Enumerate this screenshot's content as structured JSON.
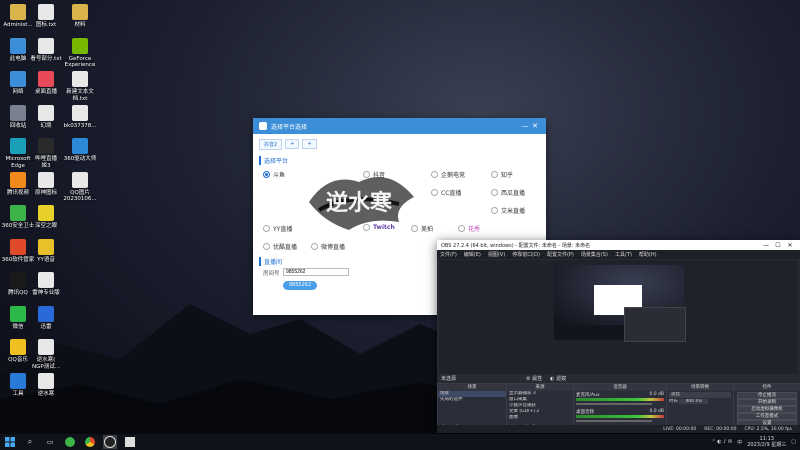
{
  "desktop": {
    "col1": [
      {
        "label": "Administ...",
        "icon": "folder-user-icon",
        "color": "#d9b44a"
      },
      {
        "label": "此电脑",
        "icon": "computer-icon",
        "color": "#3d8ed8"
      },
      {
        "label": "网络",
        "icon": "network-icon",
        "color": "#3d8ed8"
      },
      {
        "label": "回收站",
        "icon": "recycle-bin-icon",
        "color": "#7a8090"
      },
      {
        "label": "Microsoft\nEdge",
        "icon": "edge-icon",
        "color": "#1aa0b8"
      },
      {
        "label": "腾讯视频",
        "icon": "tencent-video-icon",
        "color": "#f08a1c"
      },
      {
        "label": "360安全卫士",
        "icon": "360-safe-icon",
        "color": "#3cb44a"
      },
      {
        "label": "360软件管家",
        "icon": "360-software-icon",
        "color": "#e04a2a"
      },
      {
        "label": "腾讯QQ",
        "icon": "qq-icon",
        "color": "#1a1a1a"
      },
      {
        "label": "微信",
        "icon": "wechat-icon",
        "color": "#2db84a"
      },
      {
        "label": "QQ音乐",
        "icon": "qq-music-icon",
        "color": "#f0c020"
      },
      {
        "label": "工具",
        "icon": "tools-icon",
        "color": "#2a7ad8"
      }
    ],
    "col2": [
      {
        "label": "图标.txt",
        "icon": "text-file-icon",
        "color": "#e8e8e8"
      },
      {
        "label": "看号部分.txt",
        "icon": "text-file-icon",
        "color": "#e8e8e8"
      },
      {
        "label": "桌面直播",
        "icon": "live-desktop-icon",
        "color": "#e84a5a"
      },
      {
        "label": "幻境",
        "icon": "illusion-icon",
        "color": "#e8e8e8"
      },
      {
        "label": "哔哩直播\n姬3",
        "icon": "bilibili-live-icon",
        "color": "#2a2a2a"
      },
      {
        "label": "原神图标",
        "icon": "genshin-icon",
        "color": "#e8e8e8"
      },
      {
        "label": "深空之眼",
        "icon": "deep-eye-icon",
        "color": "#e8d02a"
      },
      {
        "label": "YY语音",
        "icon": "yy-icon",
        "color": "#e8c02a"
      },
      {
        "label": "雷神专业版",
        "icon": "leishen-icon",
        "color": "#e8e8e8"
      },
      {
        "label": "迅雷",
        "icon": "xunlei-icon",
        "color": "#2a6ad8"
      },
      {
        "label": "逆水寒(\nNGP测试...",
        "icon": "nishuihan-icon",
        "color": "#e8e8e8"
      },
      {
        "label": "逆水寒",
        "icon": "nishuihan-icon",
        "color": "#e8e8e8"
      }
    ],
    "col3": [
      {
        "label": "材料",
        "icon": "folder-icon",
        "color": "#d9b44a"
      },
      {
        "label": "GeForce\nExperience",
        "icon": "geforce-icon",
        "color": "#76b900"
      },
      {
        "label": "新建文本文\n档.txt",
        "icon": "text-file-icon",
        "color": "#e8e8e8"
      },
      {
        "label": "bk037378...",
        "icon": "text-file-icon",
        "color": "#e8e8e8"
      },
      {
        "label": "360驱动大师",
        "icon": "360-driver-icon",
        "color": "#2a8ad8"
      },
      {
        "label": "QQ图片\n20230106...",
        "icon": "image-file-icon",
        "color": "#e8e8e8"
      }
    ]
  },
  "platform_window": {
    "title": "选择平台选择",
    "win_buttons": [
      "—",
      "✕"
    ],
    "tabs": [
      "抖音2",
      "+",
      "+"
    ],
    "section1": "选择平台",
    "section2": "直播间",
    "platforms": [
      {
        "label": "斗鱼",
        "selected": true
      },
      {
        "label": "抖音",
        "selected": false
      },
      {
        "label": "企鹅电竞",
        "selected": false
      },
      {
        "label": "知乎",
        "selected": false
      },
      {
        "label": "CC直播",
        "selected": false
      },
      {
        "label": "西瓜直播",
        "selected": false
      },
      {
        "label": "艾米直播",
        "selected": false
      },
      {
        "label": "Twitch",
        "selected": false
      },
      {
        "label": "美拍",
        "selected": false
      },
      {
        "label": "花秀",
        "selected": false
      },
      {
        "label": "优酷直播",
        "selected": false
      },
      {
        "label": "微博直播",
        "selected": false
      },
      {
        "label": "YY直播",
        "selected": false
      }
    ],
    "room_label": "房间号",
    "room_value": "9855262",
    "room_button": "9855262"
  },
  "banner": {
    "text": "逆水寒"
  },
  "obs": {
    "title": "OBS 27.2.4 (64 bit, windows) - 配置文件: 未命名 - 场景: 未命名",
    "win_buttons": [
      "—",
      "☐",
      "✕"
    ],
    "menu": [
      "文件(F)",
      "编辑(E)",
      "视图(V)",
      "停靠窗口(D)",
      "配置文件(P)",
      "场景集合(S)",
      "工具(T)",
      "帮助(H)"
    ],
    "source_toolbar": {
      "label": "未选源",
      "props": "属性",
      "filters": "滤镜"
    },
    "docks": {
      "scenes": {
        "title": "场景",
        "items": [
          "场景",
          "矢局的选件"
        ]
      },
      "sources": {
        "title": "来源",
        "items": [
          "显示器捕获 3",
          "窗口采集",
          "小鹿声音捕获",
          "文本 (GDI+) 2",
          "图像"
        ]
      },
      "mixer": {
        "title": "混音器",
        "channels": [
          {
            "name": "麦克风/Aux",
            "db": "0.0 dB"
          },
          {
            "name": "桌面音频",
            "db": "0.0 dB"
          }
        ]
      },
      "transitions": {
        "title": "场景转换",
        "type": "淡化",
        "duration_label": "时长",
        "duration": "400 ms"
      },
      "controls": {
        "title": "控件",
        "buttons": [
          "停止推流",
          "开始录制",
          "启动虚拟摄像机",
          "工作室模式",
          "设置",
          "退出"
        ]
      }
    },
    "status": {
      "live": "LIVE: 00:00:00",
      "rec": "REC: 00:00:00",
      "cpu": "CPU: 2.5%, 30.00 fps"
    }
  },
  "taskbar": {
    "time": "11:13",
    "date": "2023/2/9 星期三",
    "ime": "中"
  }
}
